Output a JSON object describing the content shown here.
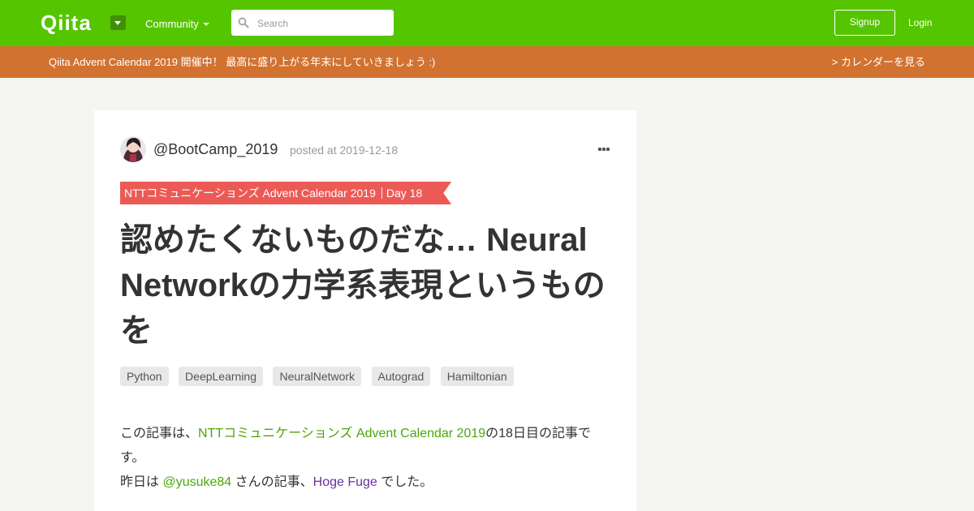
{
  "header": {
    "logo": "Qiita",
    "community_label": "Community",
    "search_placeholder": "Search",
    "signup_label": "Signup",
    "login_label": "Login"
  },
  "banner": {
    "text": "Qiita Advent Calendar 2019 開催中！ 最高に盛り上がる年末にしていきましょう :)",
    "link": "> カレンダーを見る"
  },
  "article": {
    "author": "@BootCamp_2019",
    "posted": "posted at 2019-12-18",
    "calendar": "NTTコミュニケーションズ Advent Calendar 2019",
    "day": "Day 18",
    "title": "認めたくないものだな… Neural Networkの力学系表現というものを",
    "tags": [
      "Python",
      "DeepLearning",
      "NeuralNetwork",
      "Autograd",
      "Hamiltonian"
    ],
    "intro": {
      "prefix": "この記事は、",
      "calendar_link": "NTTコミュニケーションズ Advent Calendar 2019",
      "suffix": "の18日目の記事です。",
      "yesterday_prefix": "昨日は ",
      "yesterday_user": "@yusuke84",
      "yesterday_mid": " さんの記事、",
      "yesterday_article": "Hoge Fuge",
      "yesterday_suffix": " でした。"
    }
  },
  "colors": {
    "header_green": "#55c500",
    "banner_orange": "#d17230",
    "ribbon_red": "#ec5a56",
    "link_green": "#4ba70a",
    "visited_link": "#6d2ca0"
  }
}
